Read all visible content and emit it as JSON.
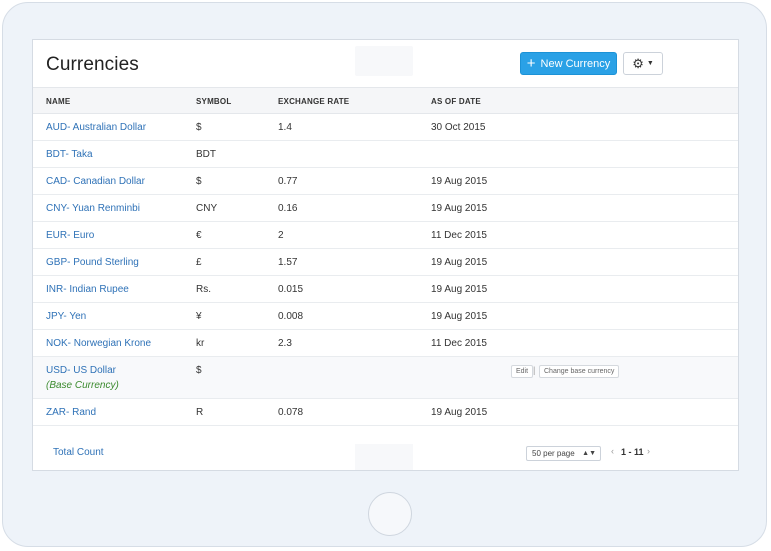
{
  "header": {
    "title": "Currencies",
    "new_button_label": "New Currency"
  },
  "columns": [
    "NAME",
    "SYMBOL",
    "EXCHANGE RATE",
    "AS OF DATE"
  ],
  "rows": [
    {
      "name": "AUD- Australian Dollar",
      "symbol": "$",
      "rate": "1.4",
      "date": "30 Oct 2015"
    },
    {
      "name": "BDT- Taka",
      "symbol": "BDT",
      "rate": "",
      "date": ""
    },
    {
      "name": "CAD- Canadian Dollar",
      "symbol": "$",
      "rate": "0.77",
      "date": "19 Aug 2015"
    },
    {
      "name": "CNY- Yuan Renminbi",
      "symbol": "CNY",
      "rate": "0.16",
      "date": "19 Aug 2015"
    },
    {
      "name": "EUR- Euro",
      "symbol": "€",
      "rate": "2",
      "date": "11 Dec 2015"
    },
    {
      "name": "GBP- Pound Sterling",
      "symbol": "£",
      "rate": "1.57",
      "date": "19 Aug 2015"
    },
    {
      "name": "INR- Indian Rupee",
      "symbol": "Rs.",
      "rate": "0.015",
      "date": "19 Aug 2015"
    },
    {
      "name": "JPY- Yen",
      "symbol": "¥",
      "rate": "0.008",
      "date": "19 Aug 2015"
    },
    {
      "name": "NOK- Norwegian Krone",
      "symbol": "kr",
      "rate": "2.3",
      "date": "11 Dec 2015"
    }
  ],
  "base_row": {
    "name": "USD- US Dollar",
    "base_label": "(Base Currency)",
    "symbol": "$",
    "edit_label": "Edit",
    "separator": "|",
    "change_label": "Change base currency"
  },
  "last_row": {
    "name": "ZAR- Rand",
    "symbol": "R",
    "rate": "0.078",
    "date": "19 Aug 2015"
  },
  "footer": {
    "total_label": "Total Count",
    "per_page": "50 per page",
    "page_range": "1 - 11"
  },
  "icons": {
    "plus": "plus-icon",
    "gear": "gear-icon",
    "prev": "chevron-left-icon",
    "next": "chevron-right-icon"
  },
  "colors": {
    "accent": "#2aa1e6",
    "link": "#2f72b7",
    "base_label": "#3b8a2e"
  }
}
